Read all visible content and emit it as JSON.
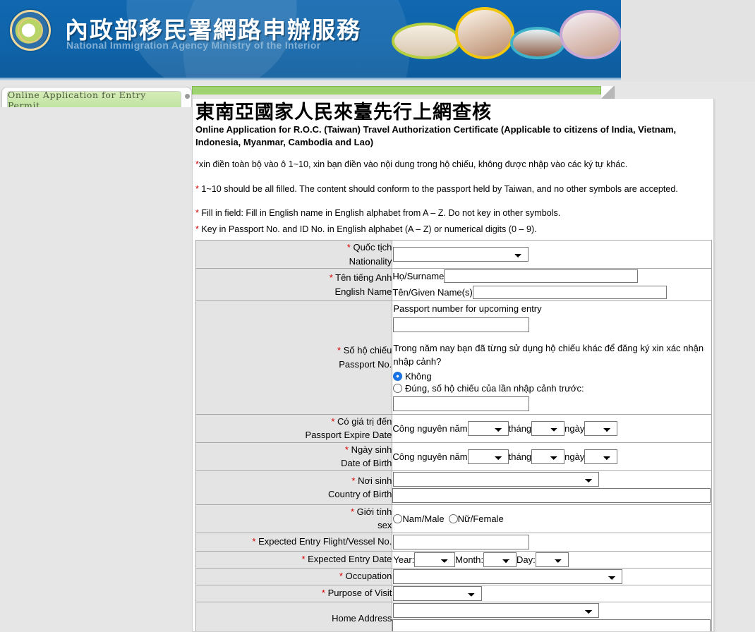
{
  "header": {
    "agency_title_zh": "內政部移民署網路申辦服務",
    "agency_title_en": "National Immigration Agency Ministry of the Interior",
    "logo_icon": "immigration-agency-seal-icon",
    "photos": [
      {
        "name": "family-photo-1",
        "ring": "#b5cf3f"
      },
      {
        "name": "family-photo-2",
        "ring": "#f2c60f"
      },
      {
        "name": "family-photo-3",
        "ring": "#3fb3c9"
      },
      {
        "name": "family-photo-4",
        "ring": "#c7a7d4"
      }
    ],
    "bg_color": "#0f63a8"
  },
  "tab": {
    "label": "Online  Application  for  Entry  Permit"
  },
  "panel": {
    "accent_color": "#9ed36f",
    "title_zh": "東南亞國家人民來臺先行上網查核",
    "title_en": "Online Application for R.O.C. (Taiwan) Travel Authorization Certificate (Applicable to citizens of India, Vietnam, Indonesia, Myanmar, Cambodia and Lao)",
    "notes": [
      "xin điền toàn bộ vào ô 1~10, xin bạn điền vào nội dung trong hộ chiếu, không được nhập vào các ký tự khác.",
      "1~10 should be all filled. The content should conform to the passport held by Taiwan, and no other symbols are accepted.",
      "Fill in field: Fill in English name in English alphabet from A – Z. Do not key in other symbols.",
      "Key in Passport No. and ID No. in English alphabet (A – Z) or numerical digits (0 – 9)."
    ]
  },
  "form": {
    "nationality": {
      "label_vi": "Quốc tịch",
      "label_en": "Nationality",
      "required": true,
      "select_value": ""
    },
    "english_name": {
      "label_vi": "Tên tiếng Anh",
      "label_en": "English Name",
      "required": true,
      "surname_label": "Họ/Surname",
      "surname_value": "",
      "given_label": "Tên/Given Name(s)",
      "given_value": ""
    },
    "passport": {
      "label_vi": "Số hộ chiếu",
      "label_en": "Passport No.",
      "required": true,
      "upcoming_label": "Passport number for upcoming entry",
      "upcoming_value": "",
      "question": "Trong năm nay bạn đã từng sử dụng hộ chiếu khác để đăng ký xin xác nhận nhập cảnh?",
      "option_no": "Không",
      "option_yes": "Đúng, số hộ chiếu của lần nhập cảnh trước:",
      "selected": "no",
      "previous_value": ""
    },
    "passport_expire": {
      "label_vi": "Có giá trị đến",
      "label_en": "Passport Expire Date",
      "required": true,
      "prefix": "Công nguyên năm",
      "month_label": "tháng",
      "day_label": "ngày",
      "year_value": "",
      "month_value": "",
      "day_value": ""
    },
    "date_of_birth": {
      "label_vi": "Ngày sinh",
      "label_en": "Date of Birth",
      "required": true,
      "prefix": "Công nguyên năm",
      "month_label": "tháng",
      "day_label": "ngày",
      "year_value": "",
      "month_value": "",
      "day_value": ""
    },
    "country_of_birth": {
      "label_vi": "Nơi sinh",
      "label_en": "Country of Birth",
      "required": true,
      "select_value": "",
      "text_value": ""
    },
    "sex": {
      "label_vi": "Giới tính",
      "label_en": "sex",
      "required": true,
      "male_label": "Nam/Male",
      "female_label": "Nữ/Female",
      "selected": ""
    },
    "flight_no": {
      "label_en": "Expected Entry Flight/Vessel No.",
      "required": true,
      "value": ""
    },
    "entry_date": {
      "label_en": "Expected Entry Date",
      "required": true,
      "year_label": "Year:",
      "month_label": "Month:",
      "day_label": "Day:",
      "year_value": "",
      "month_value": "",
      "day_value": ""
    },
    "occupation": {
      "label_en": "Occupation",
      "required": true,
      "select_value": ""
    },
    "purpose": {
      "label_en": "Purpose of Visit",
      "required": true,
      "select_value": ""
    },
    "home_address": {
      "label_en": "Home Address",
      "required": false,
      "select_value": "",
      "text_value": ""
    }
  }
}
